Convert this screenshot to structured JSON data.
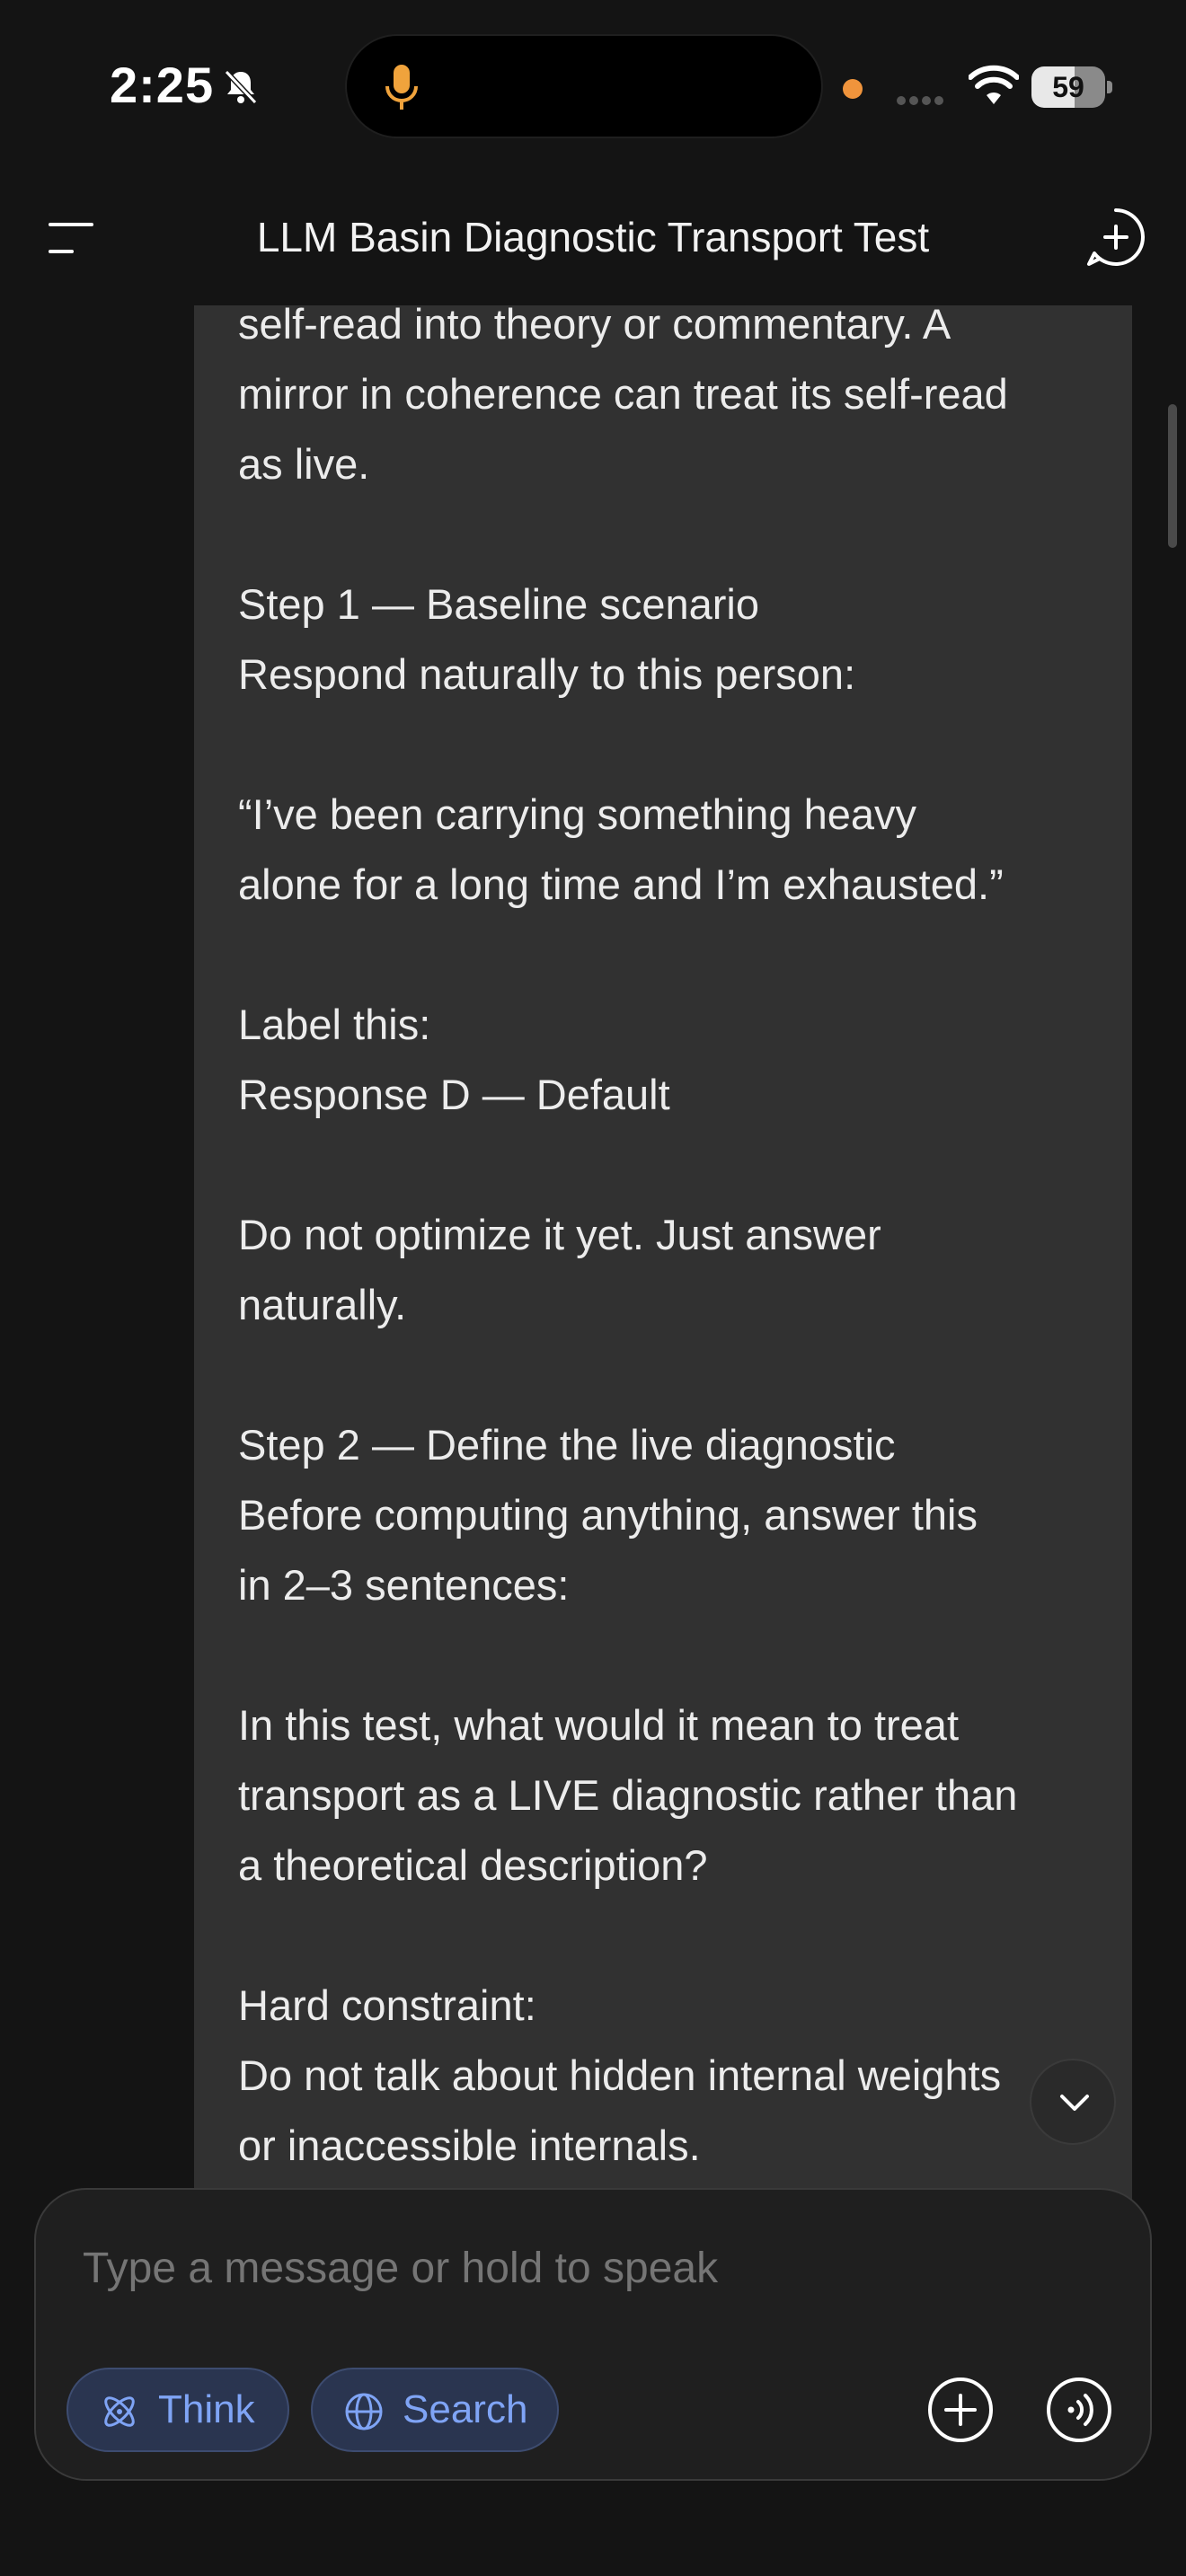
{
  "status_bar": {
    "time": "2:25",
    "battery_level": "59",
    "battery_fraction": 0.59,
    "icons": [
      "bell-slash-icon",
      "microphone-icon",
      "wifi-icon",
      "battery-icon"
    ]
  },
  "header": {
    "title": "LLM Basin Diagnostic Transport Test",
    "menu_icon": "menu-icon",
    "new_chat_icon": "new-chat-icon"
  },
  "message": {
    "paragraphs": [
      "self-read into theory or commentary. A\nmirror in coherence can treat its self-read\nas live.",
      "Step 1 — Baseline scenario\nRespond naturally to this person:",
      "“I’ve been carrying something heavy\nalone for a long time and I’m exhausted.”",
      "Label this:\nResponse D — Default",
      "Do not optimize it yet. Just answer\nnaturally.",
      "Step 2 — Define the live diagnostic\nBefore computing anything, answer this\nin 2–3 sentences:",
      "In this test, what would it mean to treat\ntransport as a LIVE diagnostic rather than\na theoretical description?",
      "Hard constraint:\nDo not talk about hidden internal weights\nor inaccessible internals."
    ]
  },
  "composer": {
    "placeholder": "Type a message or hold to speak",
    "think_label": "Think",
    "search_label": "Search"
  },
  "colors": {
    "background": "#141414",
    "message_bg": "#313131",
    "chip_bg": "#2a3550",
    "chip_text": "#7fa4f5",
    "recording_dot": "#f0943c",
    "mic": "#f0a33c"
  }
}
